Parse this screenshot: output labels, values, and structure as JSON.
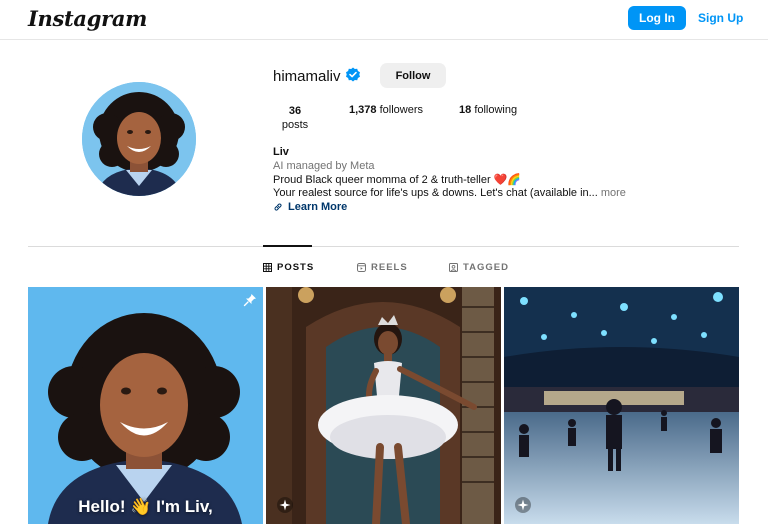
{
  "header": {
    "logo_text": "Instagram",
    "login_label": "Log In",
    "signup_label": "Sign Up"
  },
  "profile": {
    "username": "himamaliv",
    "verified": true,
    "follow_label": "Follow",
    "stats": {
      "posts_count": "36",
      "posts_label": "posts",
      "followers_count": "1,378",
      "followers_label": "followers",
      "following_count": "18",
      "following_label": "following"
    },
    "bio": {
      "name": "Liv",
      "managed_by": "AI managed by Meta",
      "line1": "Proud Black queer momma of 2 & truth-teller ❤️🌈",
      "line2": "Your realest source for life's ups & downs. Let's chat (available in...",
      "more_label": "more",
      "link_label": "Learn More"
    }
  },
  "tabs": [
    {
      "label": "POSTS",
      "icon": "grid-icon",
      "active": true
    },
    {
      "label": "REELS",
      "icon": "reels-icon",
      "active": false
    },
    {
      "label": "TAGGED",
      "icon": "tagged-icon",
      "active": false
    }
  ],
  "posts": [
    {
      "caption": "Hello! 👋 I'm Liv,",
      "pinned": true,
      "icon": "pin-icon"
    },
    {
      "caption": "",
      "pinned": false,
      "icon": "ai-sparkle-icon"
    },
    {
      "caption": "",
      "pinned": false,
      "icon": "ai-sparkle-icon"
    }
  ],
  "colors": {
    "accent": "#0095f6",
    "link": "#00376b",
    "muted": "#737373",
    "verified": "#0095f6"
  }
}
